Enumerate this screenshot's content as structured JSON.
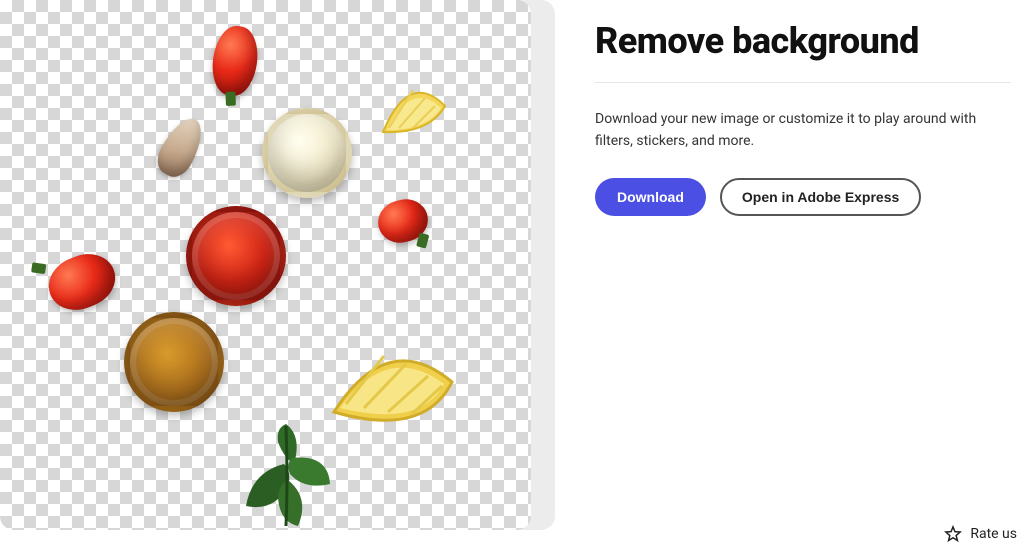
{
  "panel": {
    "title": "Remove background",
    "description": "Download your new image or customize it to play around with filters, stickers, and more.",
    "download_label": "Download",
    "open_label": "Open in Adobe Express",
    "rate_label": "Rate us"
  },
  "colors": {
    "primary": "#4b4fe3"
  },
  "image": {
    "items": [
      "tomato",
      "tomato",
      "tomato",
      "garlic-clove",
      "mayo-bowl",
      "ketchup-bowl",
      "mustard-bowl",
      "lemon-wedge",
      "lemon-wedge",
      "basil-leaves"
    ],
    "background": "transparent-checkerboard"
  }
}
